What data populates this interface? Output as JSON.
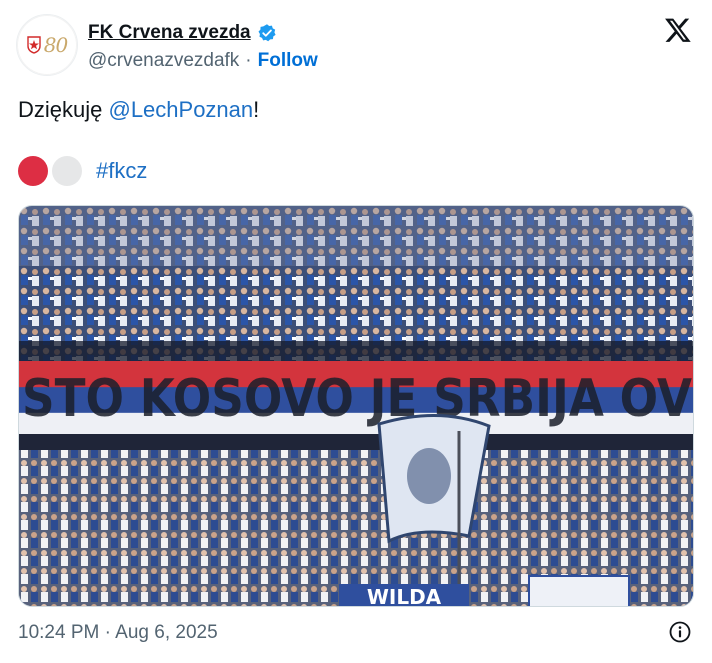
{
  "tweet": {
    "author_name": "FK Crvena zvezda",
    "handle": "@crvenazvezdafk",
    "separator": "·",
    "follow_label": "Follow",
    "avatar_text": "80",
    "text_prefix": "Dziękuję ",
    "mention": "@LechPoznan",
    "text_suffix": "!",
    "hashtag": "#fkcz",
    "timestamp": "10:24 PM · Aug 6, 2025"
  },
  "media": {
    "banner_text": "STO KOSOVO JE SRBIJA OV",
    "sign_text": "WILDA"
  },
  "colors": {
    "link": "#1d6fc4",
    "follow": "#006fd6",
    "verified": "#1d9bf0",
    "red_circle": "#dd2e44",
    "white_circle": "#e6e7e8"
  },
  "icons": [
    "verified-badge-icon",
    "x-logo-icon",
    "red-circle-emoji",
    "white-circle-emoji",
    "info-icon"
  ]
}
